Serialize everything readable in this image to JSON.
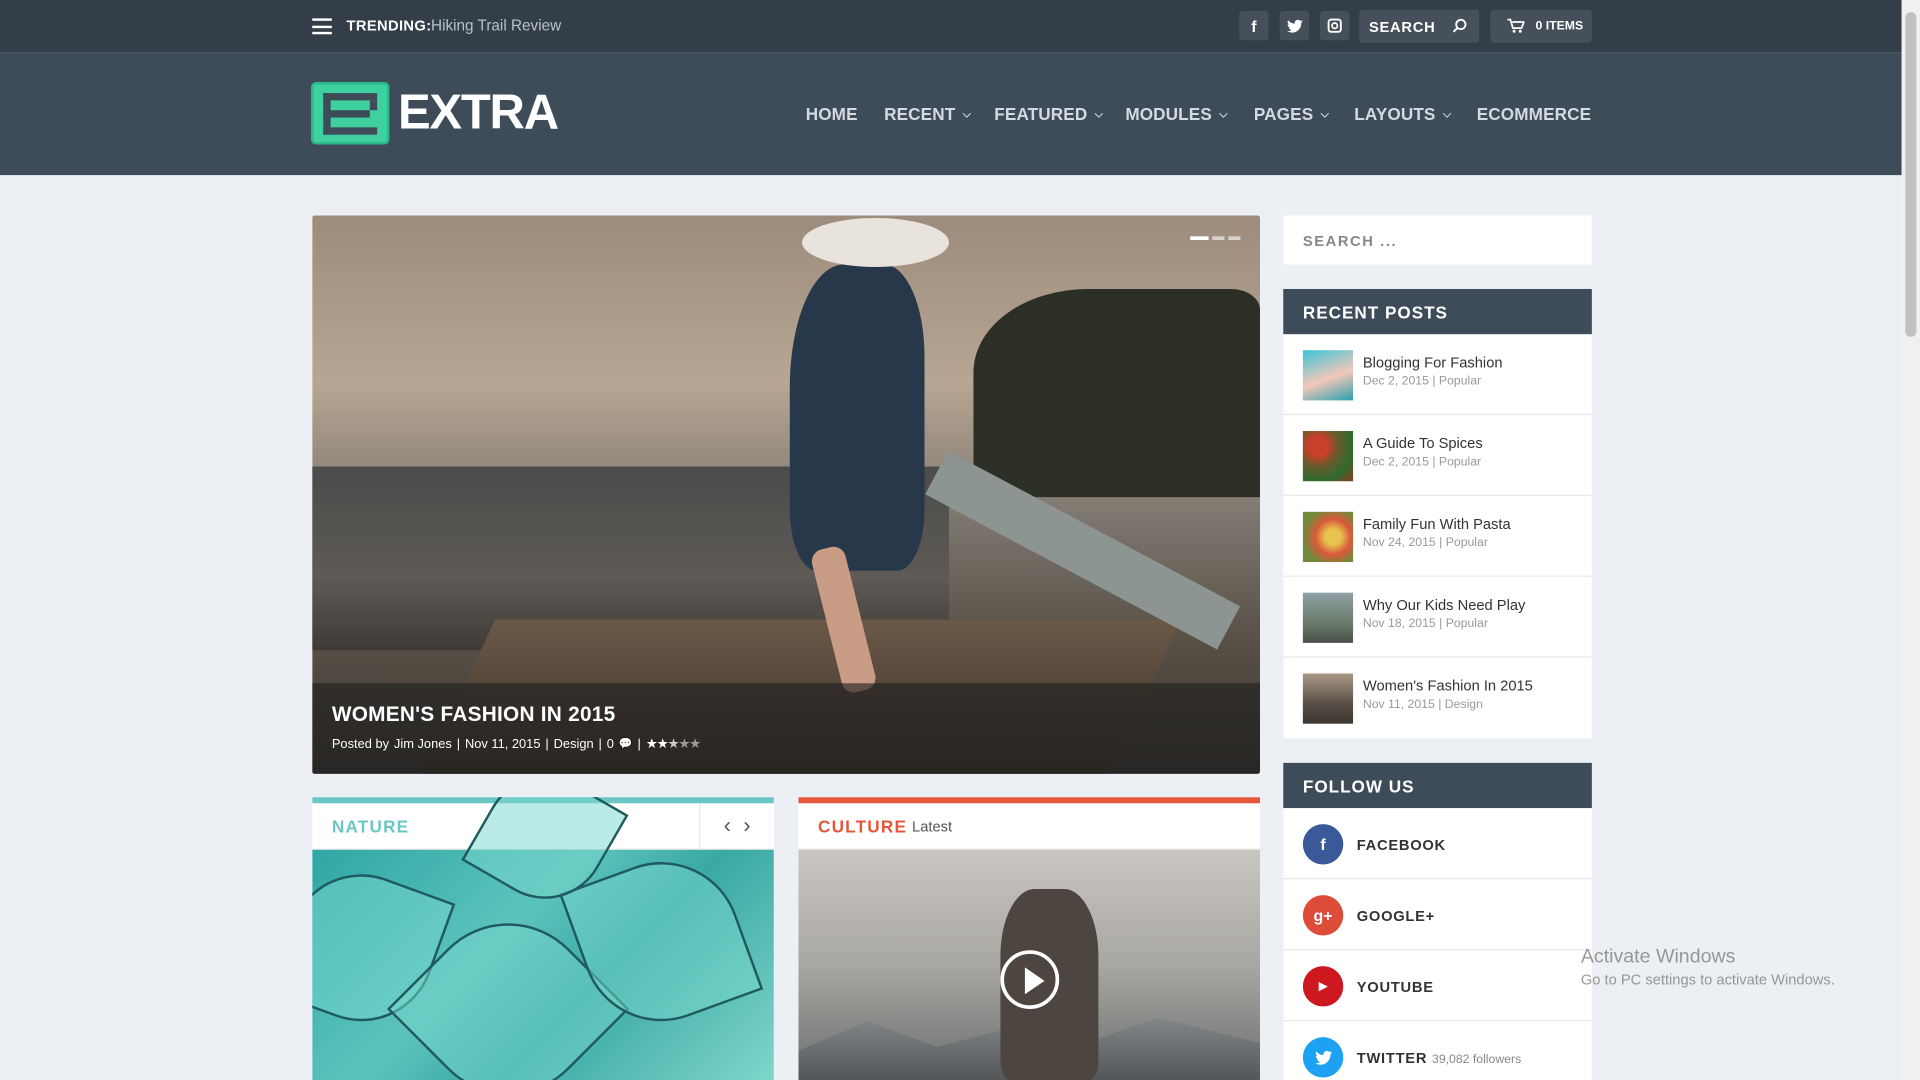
{
  "topbar": {
    "trending_label": "TRENDING:",
    "trending_link": "Hiking Trail Review",
    "social": [
      {
        "name": "facebook-icon",
        "glyph": "f"
      },
      {
        "name": "twitter-icon",
        "glyph": "t"
      },
      {
        "name": "instagram-icon",
        "glyph": "◙"
      }
    ],
    "search_label": "SEARCH",
    "cart_label": "0 ITEMS"
  },
  "header": {
    "logo_text": "EXTRA",
    "nav": [
      {
        "label": "HOME",
        "dropdown": false
      },
      {
        "label": "RECENT",
        "dropdown": true
      },
      {
        "label": "FEATURED",
        "dropdown": true
      },
      {
        "label": "MODULES",
        "dropdown": true
      },
      {
        "label": "PAGES",
        "dropdown": true
      },
      {
        "label": "LAYOUTS",
        "dropdown": true
      },
      {
        "label": "ECOMMERCE",
        "dropdown": false
      }
    ]
  },
  "hero": {
    "title": "WOMEN'S FASHION IN 2015",
    "meta_author_prefix": "Posted by",
    "meta_author": "Jim Jones",
    "meta_date": "Nov 11, 2015",
    "meta_category": "Design",
    "meta_comments": "0",
    "rating": 2.5,
    "slides": 3,
    "active_slide": 1
  },
  "cards": {
    "nature": {
      "title": "NATURE",
      "color": "#6bc7c4"
    },
    "culture": {
      "title": "CULTURE",
      "subtitle": "Latest",
      "color": "#e4573d"
    }
  },
  "sidebar": {
    "search_placeholder": "SEARCH ...",
    "recent_title": "RECENT POSTS",
    "recent": [
      {
        "title": "Blogging For Fashion",
        "date": "Dec 2, 2015",
        "category": "Popular"
      },
      {
        "title": "A Guide To Spices",
        "date": "Dec 2, 2015",
        "category": "Popular"
      },
      {
        "title": "Family Fun With Pasta",
        "date": "Nov 24, 2015",
        "category": "Popular"
      },
      {
        "title": "Why Our Kids Need Play",
        "date": "Nov 18, 2015",
        "category": "Popular"
      },
      {
        "title": "Women's Fashion In 2015",
        "date": "Nov 11, 2015",
        "category": "Design"
      }
    ],
    "follow_title": "FOLLOW US",
    "follow": [
      {
        "label": "FACEBOOK",
        "color": "#3b5998",
        "glyph": "f",
        "count": ""
      },
      {
        "label": "GOOGLE+",
        "color": "#dd4b39",
        "glyph": "g+",
        "count": ""
      },
      {
        "label": "YOUTUBE",
        "color": "#cc181e",
        "glyph": "▶",
        "count": ""
      },
      {
        "label": "TWITTER",
        "color": "#1da1f2",
        "glyph": "t",
        "count": "39,082 followers"
      }
    ]
  },
  "overlay": {
    "activate_title": "Activate Windows",
    "activate_sub": "Go to PC settings to activate Windows."
  }
}
